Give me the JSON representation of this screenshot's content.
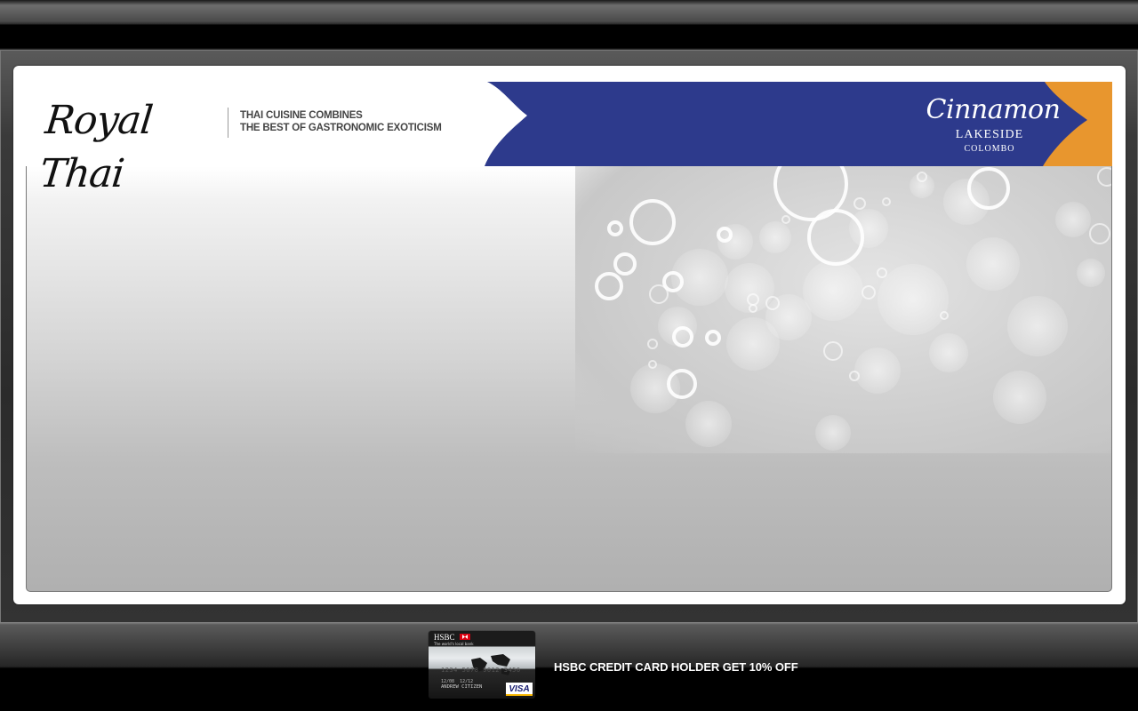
{
  "header": {
    "logo_text": "Royal Thai",
    "tagline_line1": "THAI CUISINE COMBINES",
    "tagline_line2": "THE BEST OF GASTRONOMIC EXOTICISM"
  },
  "banner": {
    "brand": "Cinnamon",
    "location": "LAKESIDE",
    "city": "COLOMBO",
    "colors": {
      "blue": "#2d3a8c",
      "orange": "#e8962e"
    }
  },
  "footer": {
    "card": {
      "bank": "HSBC",
      "slogan": "The world's local bank",
      "number": "1234 5678 9012 3456",
      "valid_from": "12/08",
      "valid_thru": "12/12",
      "holder": "ANDREW CITIZEN",
      "network": "VISA"
    },
    "offer_text": "HSBC CREDIT CARD HOLDER GET 10% OFF"
  }
}
